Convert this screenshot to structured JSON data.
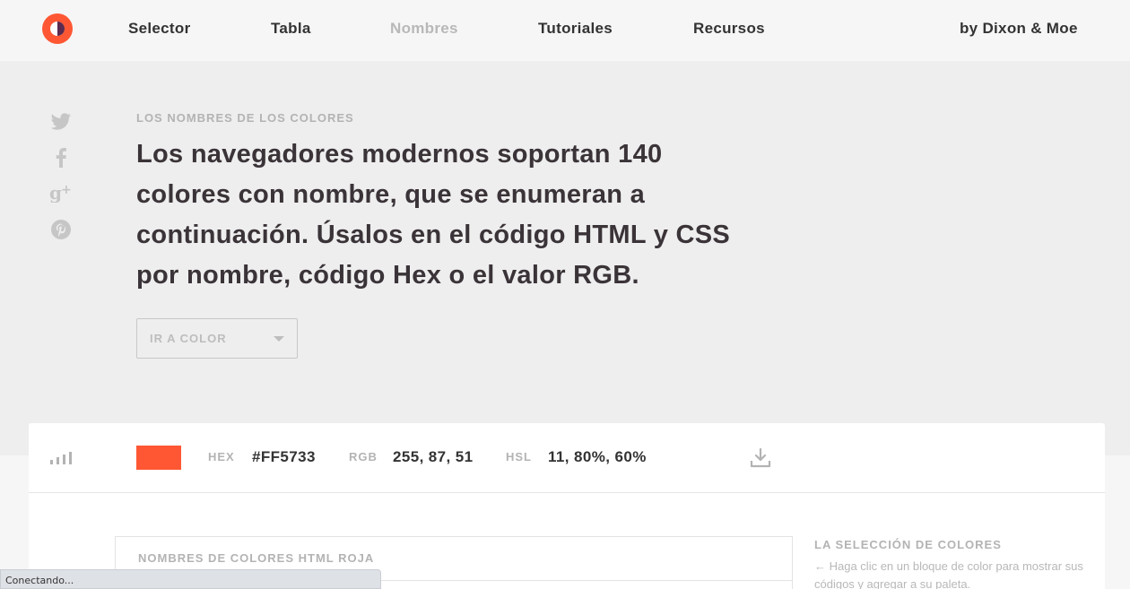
{
  "nav": {
    "links": [
      "Selector",
      "Tabla",
      "Nombres",
      "Tutoriales",
      "Recursos"
    ],
    "active": "Nombres",
    "credit": "by Dixon & Moe"
  },
  "hero": {
    "eyebrow": "LOS NOMBRES DE LOS COLORES",
    "headline": "Los navegadores modernos soportan 140 colores con nombre, que se enumeran a continuación. Úsalos en el código HTML y CSS por nombre, código Hex o el valor RGB.",
    "dropdown_label": "IR A COLOR",
    "social_icons": [
      "twitter-icon",
      "facebook-icon",
      "google-plus-icon",
      "pinterest-icon"
    ]
  },
  "color_bar": {
    "swatch_color": "#FF5733",
    "hex_label": "HEX",
    "hex_value": "#FF5733",
    "rgb_label": "RGB",
    "rgb_value": "255, 87, 51",
    "hsl_label": "HSL",
    "hsl_value": "11, 80%, 60%"
  },
  "content": {
    "table_title": "NOMBRES DE COLORES HTML ROJA",
    "side_title": "LA SELECCIÓN DE COLORES",
    "side_text": "← Haga clic en un bloque de color para mostrar sus códigos y agregar a su paleta."
  },
  "status": {
    "text": "Conectando..."
  },
  "colors": {
    "accent": "#FF5733",
    "logo_dark": "#5B2A4E",
    "hero_bg": "#EEEEEE"
  }
}
